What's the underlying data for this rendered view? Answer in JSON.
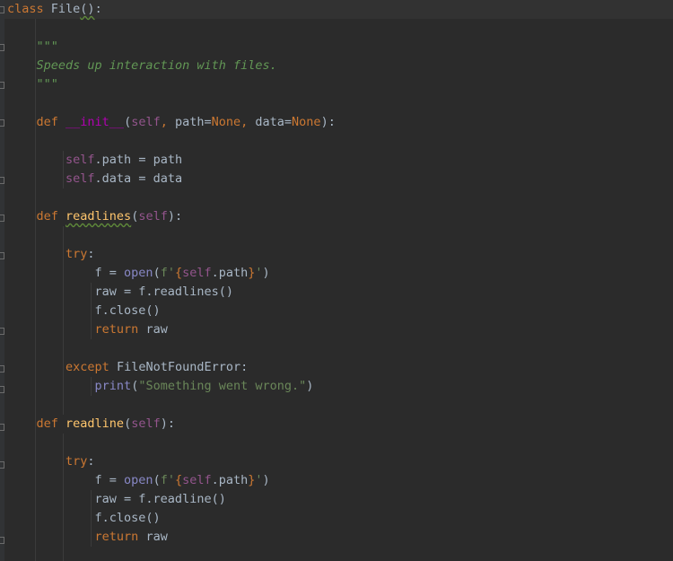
{
  "editor": {
    "language": "python",
    "theme_colors": {
      "background": "#2b2b2b",
      "keyword": "#cc7832",
      "self": "#94558d",
      "string": "#6a8759",
      "docstring": "#629755",
      "magic_method": "#b200b2",
      "function_name": "#ffc66d",
      "builtin": "#8888c6",
      "default_text": "#a9b7c6"
    },
    "lines": [
      {
        "tokens": [
          [
            "kw",
            "class "
          ],
          [
            "t",
            "File"
          ],
          [
            "squig",
            "()"
          ],
          [
            "t",
            ":"
          ]
        ]
      },
      {
        "tokens": []
      },
      {
        "tokens": [
          [
            "t",
            "    "
          ],
          [
            "doc",
            "\"\"\""
          ]
        ]
      },
      {
        "tokens": [
          [
            "t",
            "    "
          ],
          [
            "doc",
            "Speeds up interaction with files."
          ]
        ]
      },
      {
        "tokens": [
          [
            "t",
            "    "
          ],
          [
            "doc",
            "\"\"\""
          ]
        ]
      },
      {
        "tokens": []
      },
      {
        "tokens": [
          [
            "t",
            "    "
          ],
          [
            "kw",
            "def "
          ],
          [
            "magic",
            "__init__"
          ],
          [
            "t",
            "("
          ],
          [
            "self",
            "self"
          ],
          [
            "kw",
            ", "
          ],
          [
            "t",
            "path="
          ],
          [
            "kw",
            "None"
          ],
          [
            "kw",
            ", "
          ],
          [
            "t",
            "data="
          ],
          [
            "kw",
            "None"
          ],
          [
            "t",
            "):"
          ]
        ]
      },
      {
        "tokens": []
      },
      {
        "tokens": [
          [
            "t",
            "        "
          ],
          [
            "self",
            "self"
          ],
          [
            "t",
            ".path = path"
          ]
        ]
      },
      {
        "tokens": [
          [
            "t",
            "        "
          ],
          [
            "self",
            "self"
          ],
          [
            "t",
            ".data = data"
          ]
        ]
      },
      {
        "tokens": []
      },
      {
        "tokens": [
          [
            "t",
            "    "
          ],
          [
            "kw",
            "def "
          ],
          [
            "fnsquig",
            "readlines"
          ],
          [
            "t",
            "("
          ],
          [
            "self",
            "self"
          ],
          [
            "t",
            "):"
          ]
        ]
      },
      {
        "tokens": []
      },
      {
        "tokens": [
          [
            "t",
            "        "
          ],
          [
            "kw",
            "try"
          ],
          [
            "t",
            ":"
          ]
        ]
      },
      {
        "tokens": [
          [
            "t",
            "            f = "
          ],
          [
            "builtin",
            "open"
          ],
          [
            "t",
            "("
          ],
          [
            "str",
            "f'"
          ],
          [
            "brace",
            "{"
          ],
          [
            "self",
            "self"
          ],
          [
            "t",
            ".path"
          ],
          [
            "brace",
            "}"
          ],
          [
            "str",
            "'"
          ],
          [
            "t",
            ")"
          ]
        ]
      },
      {
        "tokens": [
          [
            "t",
            "            raw = f.readlines()"
          ]
        ]
      },
      {
        "tokens": [
          [
            "t",
            "            f.close()"
          ]
        ]
      },
      {
        "tokens": [
          [
            "t",
            "            "
          ],
          [
            "kw",
            "return "
          ],
          [
            "t",
            "raw"
          ]
        ]
      },
      {
        "tokens": []
      },
      {
        "tokens": [
          [
            "t",
            "        "
          ],
          [
            "kw",
            "except "
          ],
          [
            "t",
            "FileNotFoundError:"
          ]
        ]
      },
      {
        "tokens": [
          [
            "t",
            "            "
          ],
          [
            "builtin",
            "print"
          ],
          [
            "t",
            "("
          ],
          [
            "str",
            "\"Something went wrong.\""
          ],
          [
            "t",
            ")"
          ]
        ]
      },
      {
        "tokens": []
      },
      {
        "tokens": [
          [
            "t",
            "    "
          ],
          [
            "kw",
            "def "
          ],
          [
            "fn",
            "readline"
          ],
          [
            "t",
            "("
          ],
          [
            "self",
            "self"
          ],
          [
            "t",
            "):"
          ]
        ]
      },
      {
        "tokens": []
      },
      {
        "tokens": [
          [
            "t",
            "        "
          ],
          [
            "kw",
            "try"
          ],
          [
            "t",
            ":"
          ]
        ]
      },
      {
        "tokens": [
          [
            "t",
            "            f = "
          ],
          [
            "builtin",
            "open"
          ],
          [
            "t",
            "("
          ],
          [
            "str",
            "f'"
          ],
          [
            "brace",
            "{"
          ],
          [
            "self",
            "self"
          ],
          [
            "t",
            ".path"
          ],
          [
            "brace",
            "}"
          ],
          [
            "str",
            "'"
          ],
          [
            "t",
            ")"
          ]
        ]
      },
      {
        "tokens": [
          [
            "t",
            "            raw = f.readline()"
          ]
        ]
      },
      {
        "tokens": [
          [
            "t",
            "            f.close()"
          ]
        ]
      },
      {
        "tokens": [
          [
            "t",
            "            "
          ],
          [
            "kw",
            "return "
          ],
          [
            "t",
            "raw"
          ]
        ]
      },
      {
        "tokens": []
      }
    ]
  }
}
